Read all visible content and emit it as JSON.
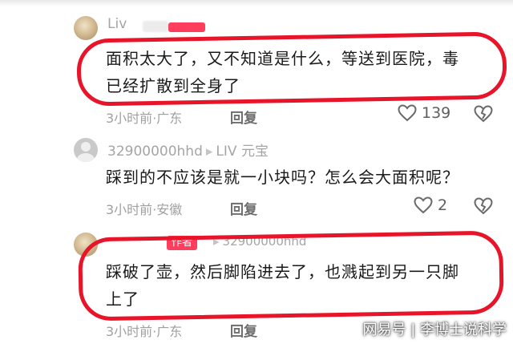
{
  "comments": [
    {
      "username": "Liv",
      "author_tag": "",
      "text_lines": [
        "面积太大了，又不知道是什么，等送到医院，毒",
        "已经扩散到全身了"
      ],
      "time": "3小时前",
      "location": "广东",
      "reply": "回复",
      "likes": "139"
    },
    {
      "username": "32900000hhd",
      "level": "LIV 元宝",
      "text_lines": [
        "踩到的不应该是就一小块吗？怎么会大面积呢？"
      ],
      "time": "3小时前",
      "location": "安徽",
      "reply": "回复",
      "likes": "2"
    },
    {
      "username": "32900000hhd",
      "author_tag": "作者",
      "text_lines": [
        "踩破了壶，然后脚陷进去了，也溅起到另一只脚",
        "上了"
      ],
      "time": "3小时前",
      "location": "广东",
      "reply": "回复",
      "likes": ""
    }
  ],
  "watermark": "网易号 | 李博士说科学",
  "colors": {
    "annotation": "#e8152a",
    "author_tag": "#ff3d5d",
    "muted": "#a5a5a5"
  }
}
